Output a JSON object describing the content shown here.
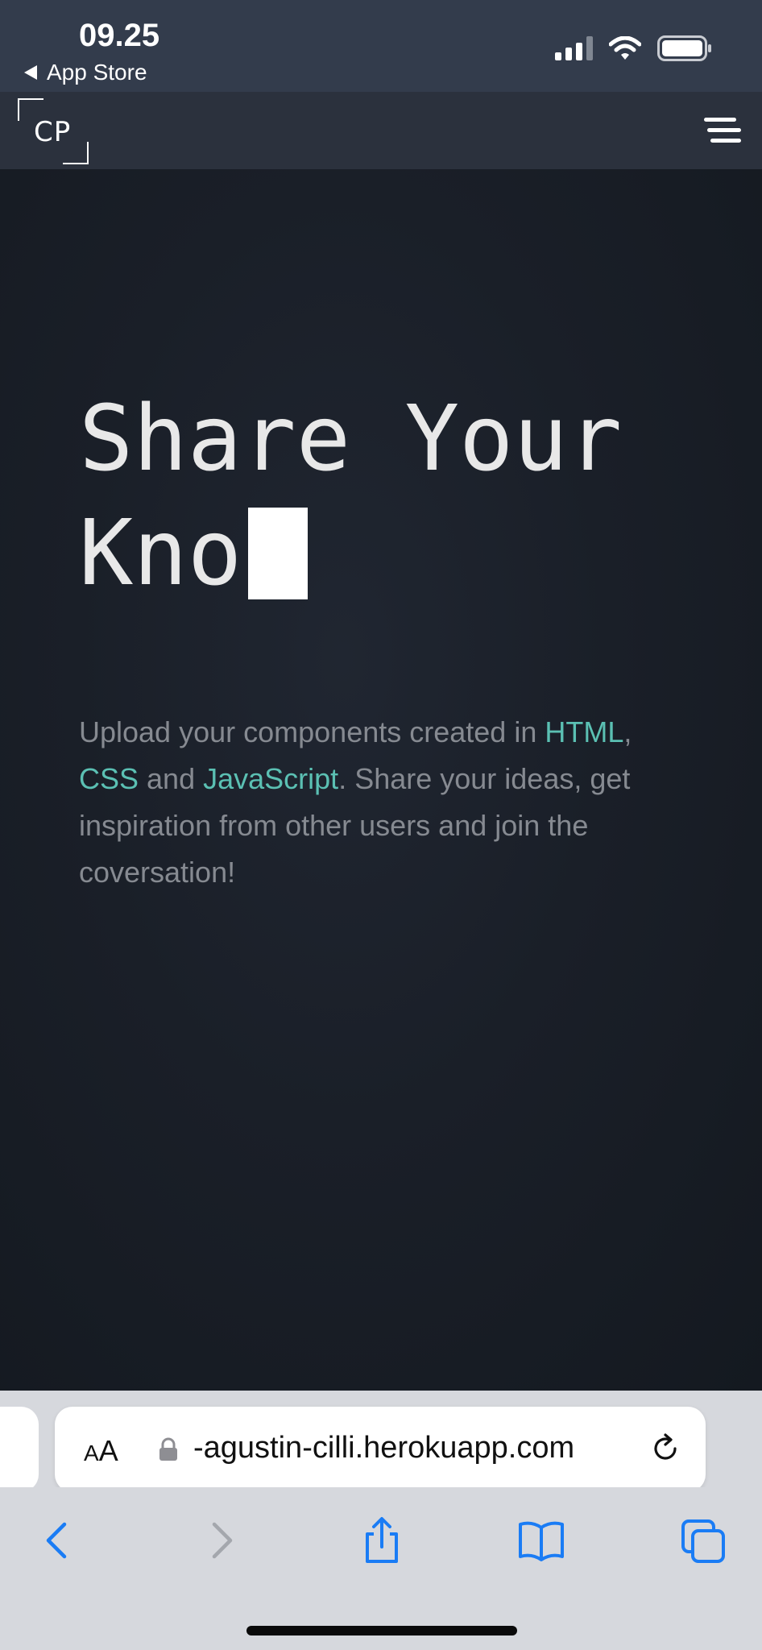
{
  "status_bar": {
    "time": "09.25",
    "back_app": "App Store"
  },
  "nav": {
    "logo_text": "CP",
    "icons": [
      "menu-icon"
    ]
  },
  "hero": {
    "title_line1": "Share Your",
    "title_line2": "Kno",
    "description_parts": [
      {
        "text": "Upload your components created in ",
        "highlight": false
      },
      {
        "text": "HTML",
        "highlight": true
      },
      {
        "text": ", ",
        "highlight": false
      },
      {
        "text": "CSS",
        "highlight": true
      },
      {
        "text": " and ",
        "highlight": false
      },
      {
        "text": "JavaScript",
        "highlight": true
      },
      {
        "text": ". Share your ideas, get inspiration from other users and join the coversation!",
        "highlight": false
      }
    ]
  },
  "browser": {
    "aa_label_small": "A",
    "aa_label_large": "A",
    "url": "-agustin-cilli.herokuapp.com",
    "toolbar_icons": [
      "back-arrow-icon",
      "forward-arrow-icon",
      "share-icon",
      "bookmarks-icon",
      "tabs-icon"
    ]
  },
  "colors": {
    "status_bg": "#333c4c",
    "nav_bg": "#2b313d",
    "hero_bg": "#1a1f28",
    "accent": "#5bc0b3",
    "body_text": "#868a91",
    "browser_bar": "#d6d8dd",
    "ios_blue": "#1a7cf5"
  }
}
